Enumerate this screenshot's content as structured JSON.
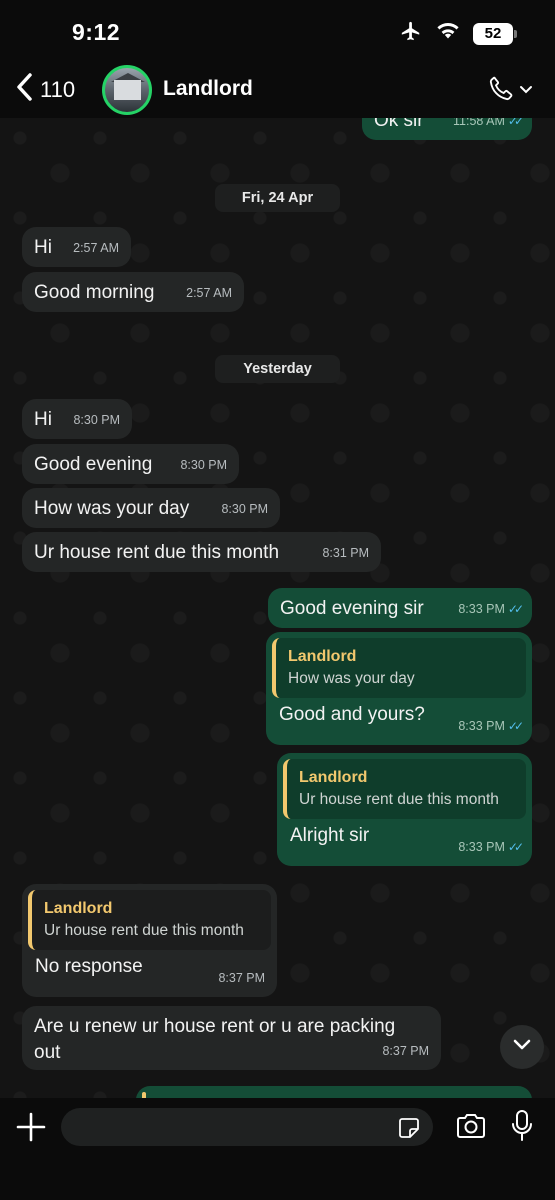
{
  "status_bar": {
    "time": "9:12",
    "battery": "52"
  },
  "header": {
    "back_count": "110",
    "contact_name": "Landlord"
  },
  "dates": {
    "first": "Fri, 24 Apr",
    "second": "Yesterday"
  },
  "messages": [
    {
      "text": "Ok sir",
      "time": "11:58 AM"
    },
    {
      "text": "Hi",
      "time": "2:57 AM"
    },
    {
      "text": "Good morning",
      "time": "2:57 AM"
    },
    {
      "text": "Hi",
      "time": "8:30 PM"
    },
    {
      "text": "Good evening",
      "time": "8:30 PM"
    },
    {
      "text": "How was your day",
      "time": "8:30 PM"
    },
    {
      "text": "Ur house rent due this month",
      "time": "8:31 PM"
    },
    {
      "text": "Good evening sir",
      "time": "8:33 PM"
    },
    {
      "quote_name": "Landlord",
      "quote_text": "How was your day",
      "text": "Good and yours?",
      "time": "8:33 PM"
    },
    {
      "quote_name": "Landlord",
      "quote_text": "Ur house rent due this month",
      "text": "Alright sir",
      "time": "8:33 PM"
    },
    {
      "quote_name": "Landlord",
      "quote_text": "Ur house rent due this month",
      "text": "No response",
      "time": "8:37 PM"
    },
    {
      "text": "Are u renew ur house rent or u are packing out",
      "time": "8:37 PM"
    }
  ],
  "colors": {
    "incoming": "#242626",
    "outgoing": "#144d37",
    "quote_accent": "#f2c86e",
    "read_ticks": "#53bdeb",
    "avatar_ring": "#25d366"
  },
  "icons": [
    "back-chevron-icon",
    "airplane-icon",
    "wifi-icon",
    "phone-icon",
    "chevron-down-icon",
    "plus-icon",
    "sticker-icon",
    "camera-icon",
    "mic-icon",
    "read-receipt-icon"
  ]
}
